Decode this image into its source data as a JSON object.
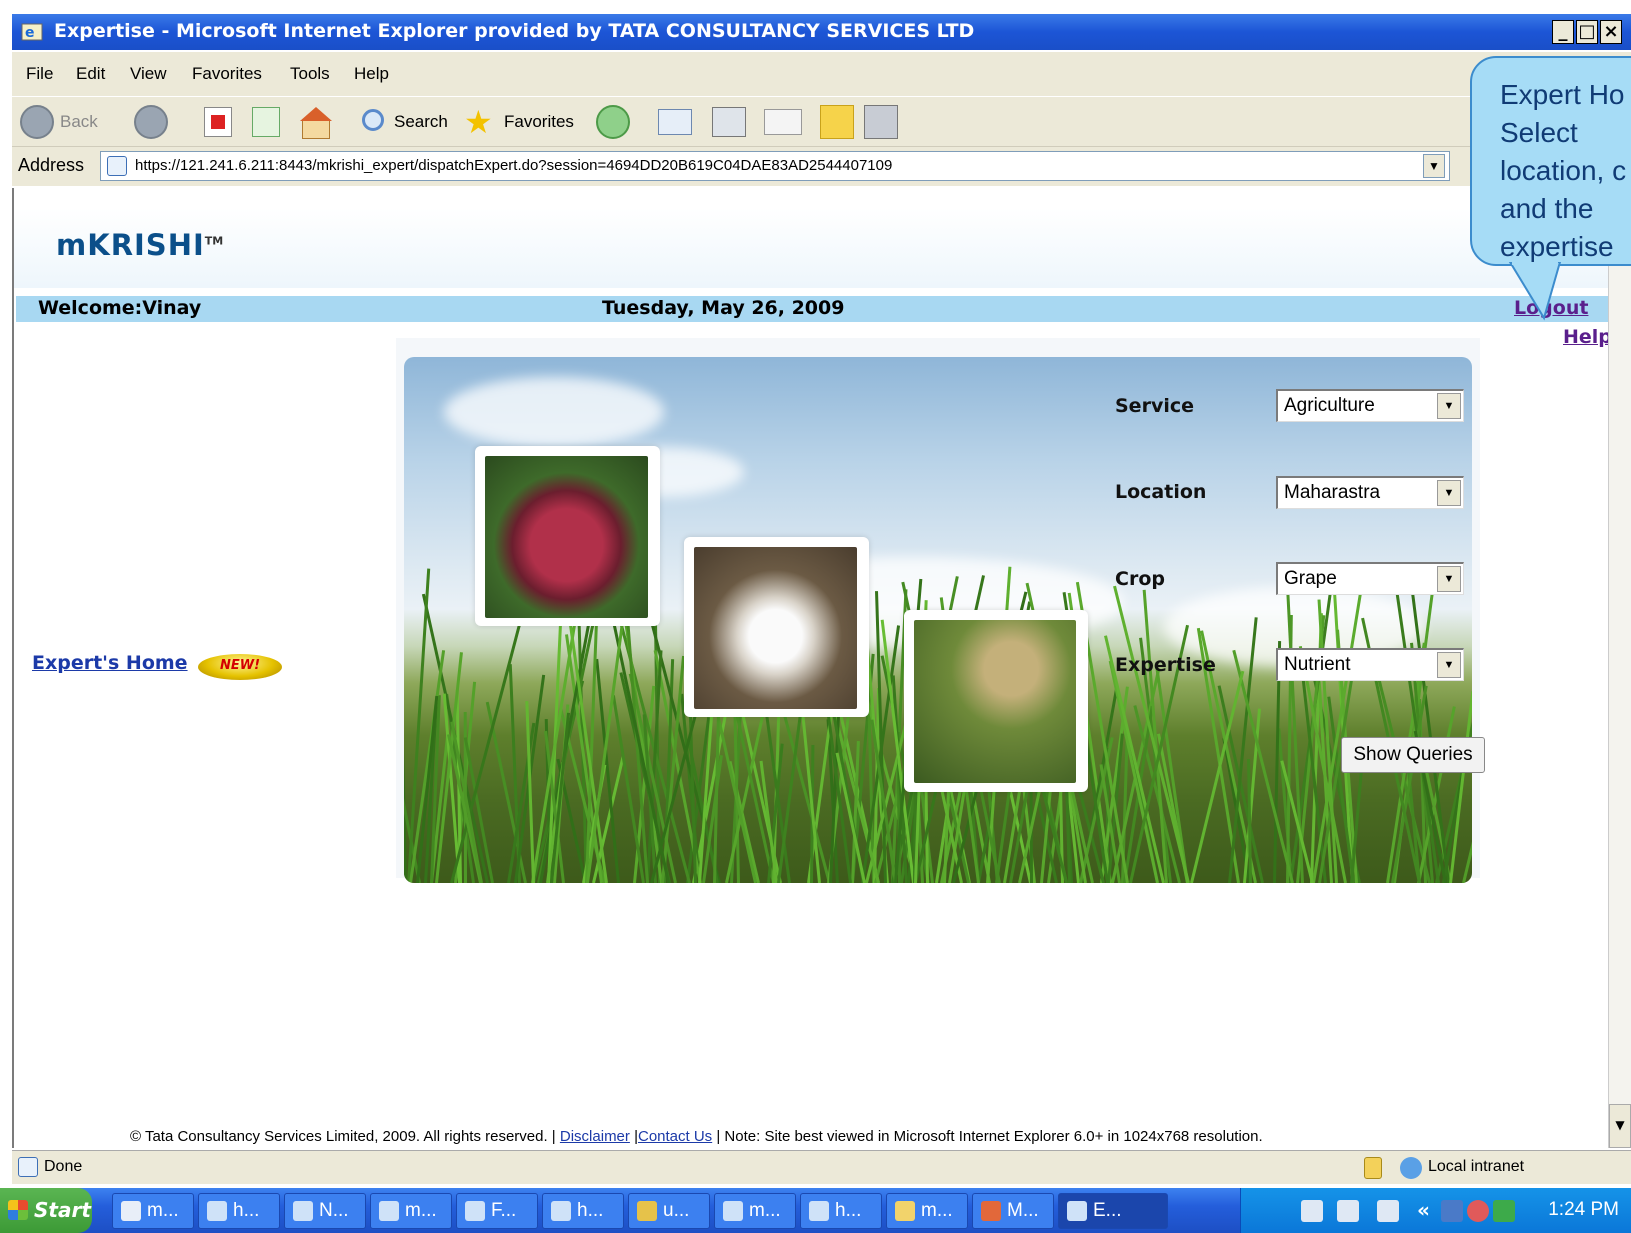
{
  "window": {
    "title": "Expertise - Microsoft Internet Explorer provided by TATA CONSULTANCY SERVICES LTD",
    "buttons": {
      "minimize": "_",
      "maximize": "□",
      "close": "×"
    }
  },
  "menu": [
    "File",
    "Edit",
    "View",
    "Favorites",
    "Tools",
    "Help"
  ],
  "toolbar": {
    "back": "Back",
    "search": "Search",
    "favorites": "Favorites"
  },
  "address": {
    "label": "Address",
    "url": "https://121.241.6.211:8443/mkrishi_expert/dispatchExpert.do?session=4694DD20B619C04DAE83AD2544407109"
  },
  "page": {
    "logo": "mKRISHI",
    "logo_tm": "TM",
    "welcome": "Welcome:Vinay",
    "date": "Tuesday, May 26, 2009",
    "logout": "Logout",
    "help": "Help",
    "expert_home": "Expert's Home",
    "new_badge": "NEW!",
    "form": {
      "service_label": "Service",
      "service_value": "Agriculture",
      "location_label": "Location",
      "location_value": "Maharastra",
      "crop_label": "Crop",
      "crop_value": "Grape",
      "expertise_label": "Expertise",
      "expertise_value": "Nutrient",
      "show_queries": "Show Queries"
    },
    "footer": {
      "copyright": "© Tata Consultancy Services Limited, 2009. All rights reserved. |",
      "disclaimer": "Disclaimer",
      "sep": "|",
      "contact": "Contact Us",
      "note": "| Note: Site best viewed in Microsoft Internet Explorer 6.0+ in 1024x768 resolution."
    }
  },
  "statusbar": {
    "status": "Done",
    "zone": "Local intranet"
  },
  "callout": {
    "lines": [
      "Expert Ho",
      "Select",
      "location, c",
      "and the",
      "expertise"
    ]
  },
  "taskbar": {
    "start": "Start",
    "tasks": [
      "m...",
      "h...",
      "N...",
      "m...",
      "F...",
      "h...",
      "u...",
      "m...",
      "h...",
      "m...",
      "M...",
      "E..."
    ],
    "clock": "1:24 PM"
  }
}
